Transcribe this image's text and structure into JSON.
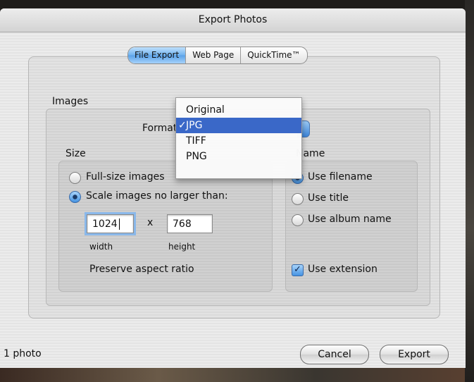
{
  "window": {
    "title": "Export Photos"
  },
  "tabs": [
    {
      "label": "File Export",
      "active": true
    },
    {
      "label": "Web Page",
      "active": false
    },
    {
      "label": "QuickTime™",
      "active": false
    }
  ],
  "images": {
    "title": "Images",
    "format_label": "Format",
    "format_value": "JPG",
    "format_options": [
      "Original",
      "JPG",
      "TIFF",
      "PNG"
    ]
  },
  "size": {
    "title": "Size",
    "options": [
      {
        "label": "Full-size images",
        "selected": false
      },
      {
        "label": "Scale images no larger than:",
        "selected": true
      }
    ],
    "width_value": "1024",
    "height_value": "768",
    "times": "x",
    "width_label": "width",
    "height_label": "height",
    "preserve_label": "Preserve aspect ratio"
  },
  "name": {
    "title_partial": "Name",
    "options": [
      {
        "label": "Use filename",
        "selected": true
      },
      {
        "label": "Use title",
        "selected": false
      },
      {
        "label": "Use album name",
        "selected": false
      }
    ],
    "extension_label": "Use extension",
    "extension_checked": true
  },
  "footer": {
    "count": "1 photo",
    "cancel_label": "Cancel",
    "export_label": "Export"
  },
  "colors": {
    "accent": "#3a68c8",
    "tab_active": "#6fb2ef"
  }
}
